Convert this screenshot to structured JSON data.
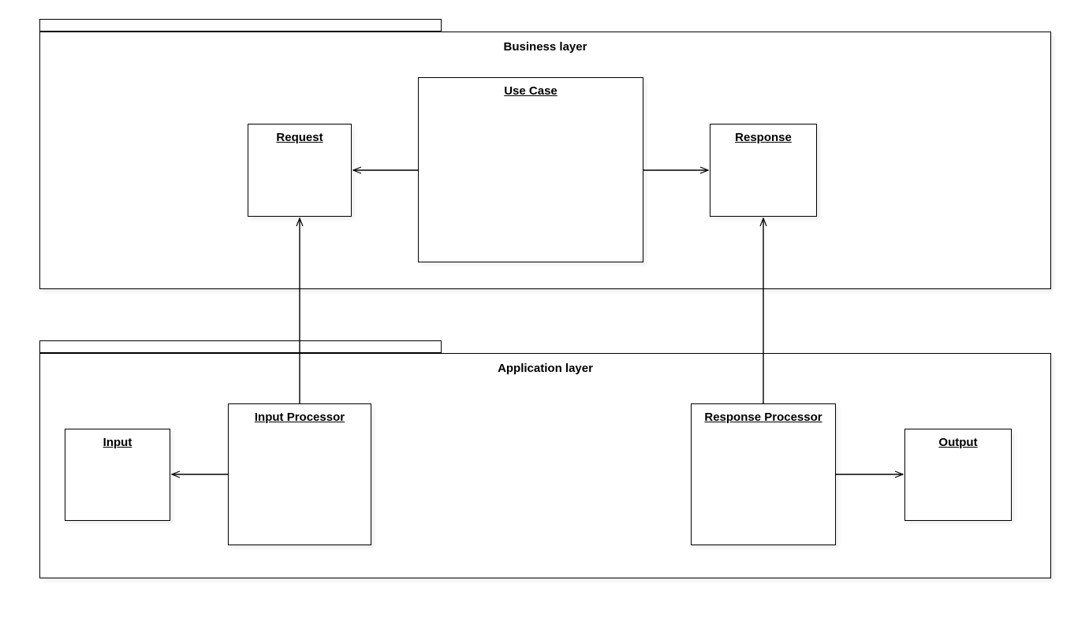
{
  "layers": {
    "business": {
      "title": "Business layer"
    },
    "application": {
      "title": "Application layer"
    }
  },
  "nodes": {
    "request": {
      "label": "Request"
    },
    "usecase": {
      "label": "Use Case"
    },
    "response": {
      "label": "Response"
    },
    "input": {
      "label": "Input"
    },
    "inputproc": {
      "label": "Input Processor"
    },
    "responseproc": {
      "label": "Response Processor"
    },
    "output": {
      "label": "Output"
    }
  }
}
